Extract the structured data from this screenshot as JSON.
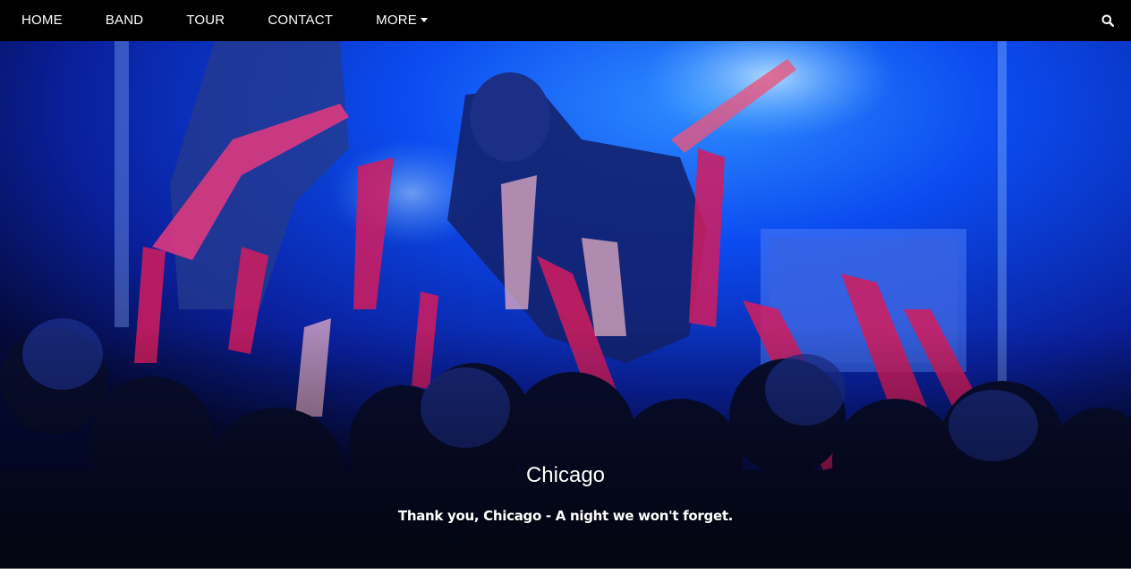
{
  "nav": {
    "items": [
      {
        "label": "HOME"
      },
      {
        "label": "BAND"
      },
      {
        "label": "TOUR"
      },
      {
        "label": "CONTACT"
      }
    ],
    "more_label": "MORE",
    "more_icon": "caret-down-icon",
    "search_icon": "search-icon"
  },
  "hero": {
    "title": "Chicago",
    "text": "Thank you, Chicago - A night we won't forget."
  },
  "colors": {
    "navbar_bg": "#000000",
    "stage_blue": "#0a3cff",
    "stage_pink": "#e0186e",
    "page_bg": "#ffffff"
  }
}
